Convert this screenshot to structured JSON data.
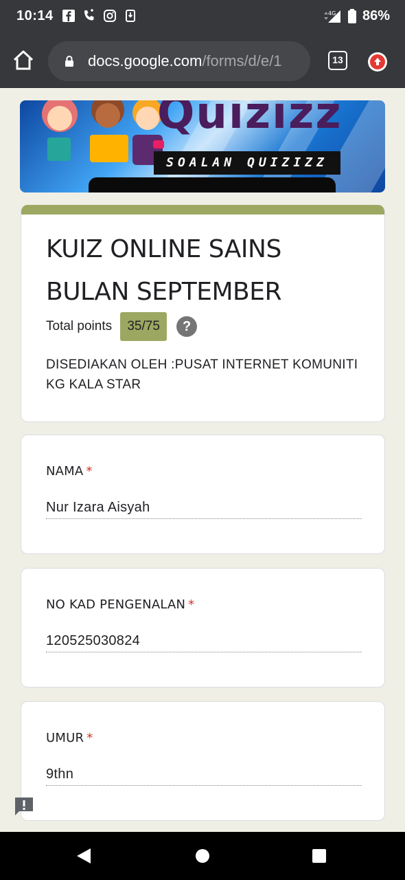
{
  "status_bar": {
    "time": "10:14",
    "network": "4G",
    "battery": "86%",
    "icons": [
      "facebook-icon",
      "call-icon",
      "instagram-icon",
      "download-icon",
      "signal-icon",
      "battery-icon"
    ]
  },
  "browser": {
    "url_domain": "docs.google.com",
    "url_path": "/forms/d/e/1",
    "tab_count": "13"
  },
  "banner": {
    "logo_text": "Quizizz",
    "strip_text": "SOALAN QUIZIZZ"
  },
  "form": {
    "title": "KUIZ ONLINE SAINS BULAN SEPTEMBER",
    "points_label": "Total points",
    "points_value": "35/75",
    "help_glyph": "?",
    "description": "DISEDIAKAN OLEH :PUSAT INTERNET KOMUNITI KG KALA STAR",
    "accent_color": "#9ca862"
  },
  "questions": [
    {
      "label": "NAMA",
      "required_mark": "*",
      "answer": "Nur Izara Aisyah"
    },
    {
      "label": "NO KAD PENGENALAN",
      "required_mark": "*",
      "answer": "120525030824"
    },
    {
      "label": "UMUR",
      "required_mark": "*",
      "answer": "9thn"
    }
  ]
}
